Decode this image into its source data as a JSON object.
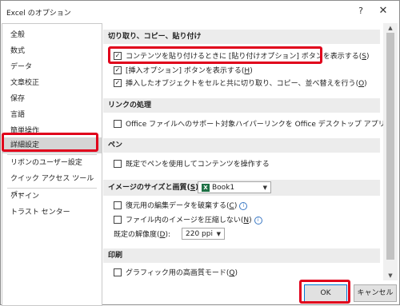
{
  "window": {
    "title": "Excel のオプション",
    "help_label": "?",
    "close_label": "✕"
  },
  "sidebar": {
    "items": [
      {
        "label": "全般"
      },
      {
        "label": "数式"
      },
      {
        "label": "データ"
      },
      {
        "label": "文章校正"
      },
      {
        "label": "保存"
      },
      {
        "label": "言語"
      },
      {
        "label": "簡単操作"
      },
      {
        "label": "詳細設定",
        "selected": true
      },
      {
        "label": "リボンのユーザー設定"
      },
      {
        "label": "クイック アクセス ツール バー"
      },
      {
        "label": "アドイン"
      },
      {
        "label": "トラスト センター"
      }
    ]
  },
  "main": {
    "sections": {
      "cut_copy_paste": {
        "title": "切り取り、コピー、貼り付け",
        "options": [
          {
            "label": "コンテンツを貼り付けるときに [貼り付けオプション] ボタンを表示する",
            "accel": "S",
            "checked": true
          },
          {
            "label": "[挿入オプション] ボタンを表示する",
            "accel": "H",
            "checked": true
          },
          {
            "label": "挿入したオブジェクトをセルと共に切り取り、コピー、並べ替えを行う",
            "accel": "O",
            "checked": true
          }
        ]
      },
      "link_handling": {
        "title": "リンクの処理",
        "options": [
          {
            "label": "Office ファイルへのサポート対象ハイパーリンクを Office デスクトップ アプリで開く",
            "checked": false
          }
        ]
      },
      "pen": {
        "title": "ペン",
        "options": [
          {
            "label": "既定でペンを使用してコンテンツを操作する",
            "checked": false
          }
        ]
      },
      "image": {
        "title": "イメージのサイズと画質",
        "accel": "S",
        "workbook_select": "Book1",
        "options": [
          {
            "label": "復元用の編集データを破棄する",
            "accel": "C",
            "checked": false
          },
          {
            "label": "ファイル内のイメージを圧縮しない",
            "accel": "N",
            "checked": false
          }
        ],
        "resolution_label": "既定の解像度",
        "resolution_accel": "D",
        "resolution_value": "220 ppi"
      },
      "print": {
        "title": "印刷",
        "options": [
          {
            "label": "グラフィック用の高画質モード",
            "accel": "Q",
            "checked": false
          }
        ]
      }
    }
  },
  "footer": {
    "ok_label": "OK",
    "cancel_label": "キャンセル"
  },
  "colors": {
    "highlight": "#e0001b",
    "excel_green": "#1e7145",
    "section_bg": "#ececec",
    "selected_bg": "#d5d5d5"
  }
}
